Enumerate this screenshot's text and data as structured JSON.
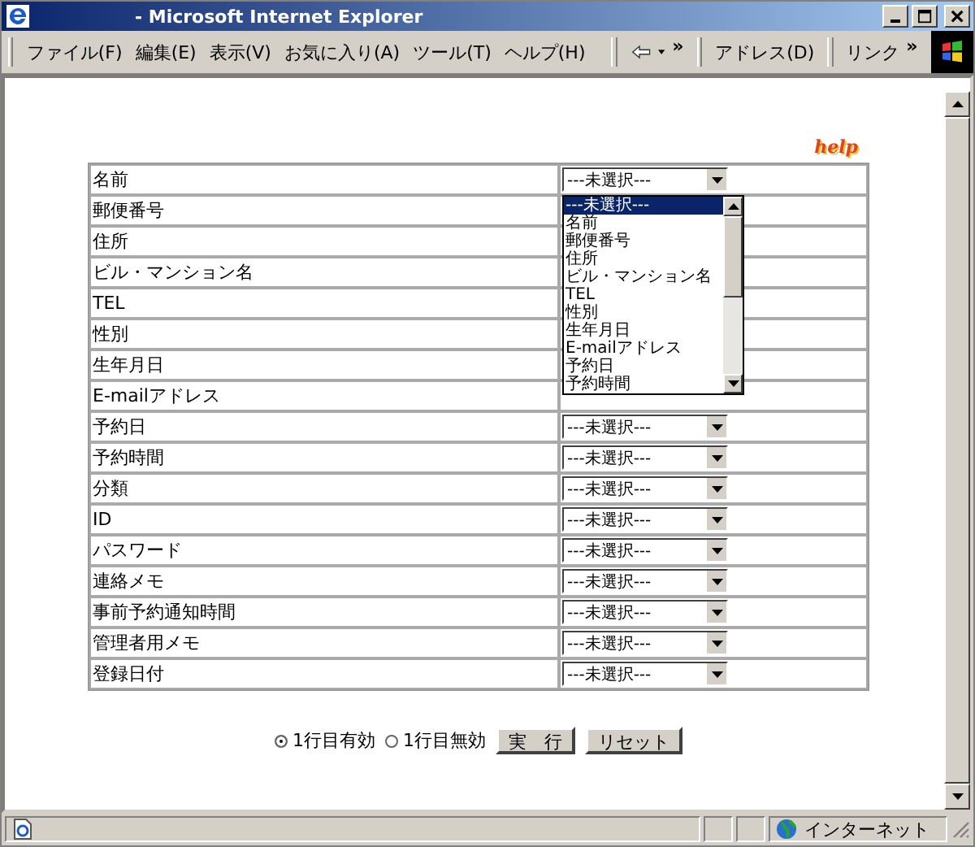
{
  "window": {
    "title": "- Microsoft Internet Explorer"
  },
  "menu": [
    "ファイル(F)",
    "編集(E)",
    "表示(V)",
    "お気に入り(A)",
    "ツール(T)",
    "ヘルプ(H)"
  ],
  "toolbar": {
    "chevron": "»",
    "address_label": "アドレス(D)",
    "links_label": "リンク",
    "links_chevron": "»"
  },
  "help_logo": "help",
  "rows": [
    {
      "field": "名前",
      "value": "---未選択---"
    },
    {
      "field": "郵便番号"
    },
    {
      "field": "住所"
    },
    {
      "field": "ビル・マンション名"
    },
    {
      "field": "TEL"
    },
    {
      "field": "性別"
    },
    {
      "field": "生年月日"
    },
    {
      "field": "E-mailアドレス"
    },
    {
      "field": "予約日",
      "value": "---未選択---"
    },
    {
      "field": "予約時間",
      "value": "---未選択---"
    },
    {
      "field": "分類",
      "value": "---未選択---"
    },
    {
      "field": "ID",
      "value": "---未選択---"
    },
    {
      "field": "パスワード",
      "value": "---未選択---"
    },
    {
      "field": "連絡メモ",
      "value": "---未選択---"
    },
    {
      "field": "事前予約通知時間",
      "value": "---未選択---"
    },
    {
      "field": "管理者用メモ",
      "value": "---未選択---"
    },
    {
      "field": "登録日付",
      "value": "---未選択---"
    }
  ],
  "dropdown_options": [
    {
      "label": "---未選択---",
      "selected": true
    },
    {
      "label": "名前",
      "selected": false
    },
    {
      "label": "郵便番号",
      "selected": false
    },
    {
      "label": "住所",
      "selected": false
    },
    {
      "label": "ビル・マンション名",
      "selected": false
    },
    {
      "label": "TEL",
      "selected": false
    },
    {
      "label": "性別",
      "selected": false
    },
    {
      "label": "生年月日",
      "selected": false
    },
    {
      "label": "E-mailアドレス",
      "selected": false
    },
    {
      "label": "予約日",
      "selected": false
    },
    {
      "label": "予約時間",
      "selected": false
    }
  ],
  "radios": [
    {
      "label": "1行目有効",
      "selected": true
    },
    {
      "label": "1行目無効",
      "selected": false
    }
  ],
  "buttons": [
    "実　行",
    "リセット"
  ],
  "status_bar": {
    "zone": "インターネット"
  }
}
